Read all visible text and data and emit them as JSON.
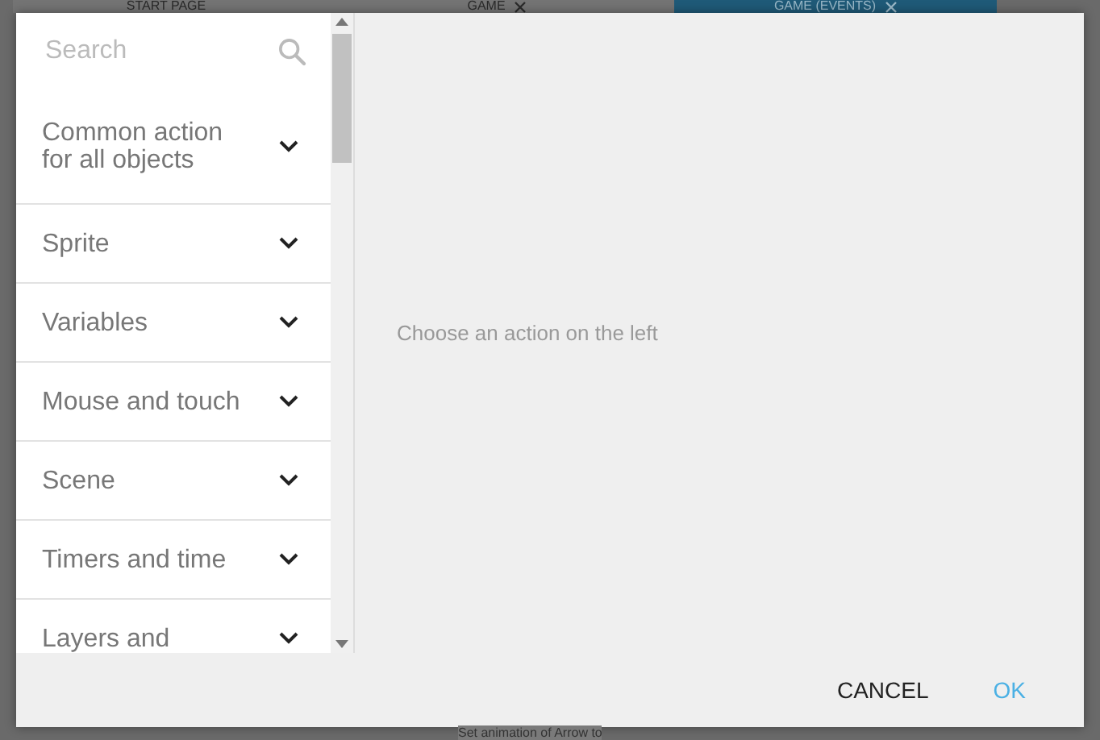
{
  "background": {
    "tabs": [
      {
        "label": "START PAGE",
        "closable": false,
        "selected": false
      },
      {
        "label": "GAME",
        "closable": true,
        "selected": false
      },
      {
        "label": "GAME (EVENTS)",
        "closable": true,
        "selected": true
      }
    ],
    "event_line": "Set animation of Arrow to"
  },
  "dialog": {
    "search": {
      "placeholder": "Search"
    },
    "categories": [
      {
        "label": "Common action for all objects",
        "expanded": false
      },
      {
        "label": "Sprite",
        "expanded": false
      },
      {
        "label": "Variables",
        "expanded": false
      },
      {
        "label": "Mouse and touch",
        "expanded": false
      },
      {
        "label": "Scene",
        "expanded": false
      },
      {
        "label": "Timers and time",
        "expanded": false
      },
      {
        "label": "Layers and",
        "expanded": false
      }
    ],
    "hint": "Choose an action on the left",
    "buttons": [
      {
        "label": "CANCEL",
        "kind": "secondary"
      },
      {
        "label": "OK",
        "kind": "primary"
      }
    ]
  }
}
